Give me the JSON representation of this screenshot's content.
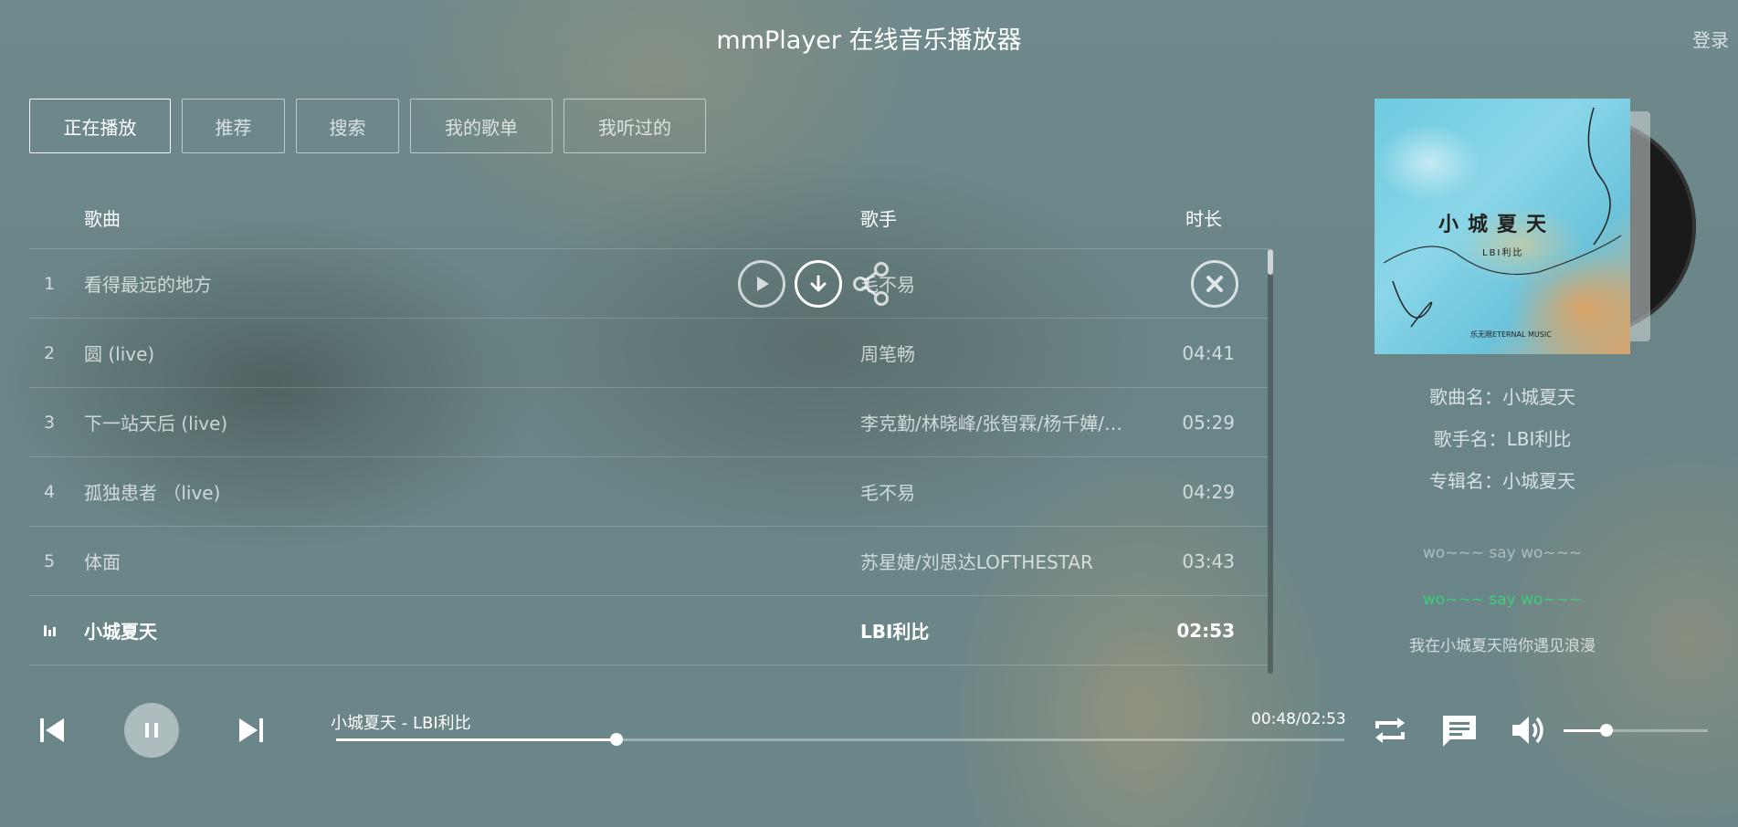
{
  "app": {
    "title": "mmPlayer 在线音乐播放器",
    "login": "登录"
  },
  "tabs": [
    {
      "label": "正在播放",
      "active": true
    },
    {
      "label": "推荐"
    },
    {
      "label": "搜索"
    },
    {
      "label": "我的歌单"
    },
    {
      "label": "我听过的"
    }
  ],
  "list": {
    "headers": {
      "song": "歌曲",
      "singer": "歌手",
      "duration": "时长"
    },
    "rows": [
      {
        "num": "1",
        "name": "看得最远的地方",
        "singer": "毛不易",
        "duration": ""
      },
      {
        "num": "2",
        "name": "圆 (live)",
        "singer": "周笔畅",
        "duration": "04:41"
      },
      {
        "num": "3",
        "name": "下一站天后 (live)",
        "singer": "李克勤/林晓峰/张智霖/杨千嬅/…",
        "duration": "05:29"
      },
      {
        "num": "4",
        "name": "孤独患者 （live)",
        "singer": "毛不易",
        "duration": "04:29"
      },
      {
        "num": "5",
        "name": "体面",
        "singer": "苏星婕/刘思达LOFTHESTAR",
        "duration": "03:43"
      },
      {
        "num": "",
        "name": "小城夏天",
        "singer": "LBI利比",
        "duration": "02:53",
        "playing": true
      }
    ],
    "row_actions": [
      "play-icon",
      "download-icon",
      "share-icon",
      "delete-icon"
    ]
  },
  "album": {
    "cover_title": "小城夏天",
    "cover_artist": "LBI利比",
    "cover_label": "乐无限ETERNAL MUSIC"
  },
  "info": {
    "song": "歌曲名：小城夏天",
    "singer": "歌手名：LBI利比",
    "album": "专辑名：小城夏天"
  },
  "lyrics": {
    "prev": "wo~~~ say wo~~~",
    "current": "wo~~~ say wo~~~",
    "next": "我在小城夏天陪你遇见浪漫"
  },
  "player": {
    "now_title": "小城夏天 - LBI利比",
    "time": "00:48/02:53",
    "progress": 0.278,
    "volume": 0.3
  },
  "colors": {
    "lyric_current": "#3ccf7a",
    "accent": "#ffffff"
  }
}
